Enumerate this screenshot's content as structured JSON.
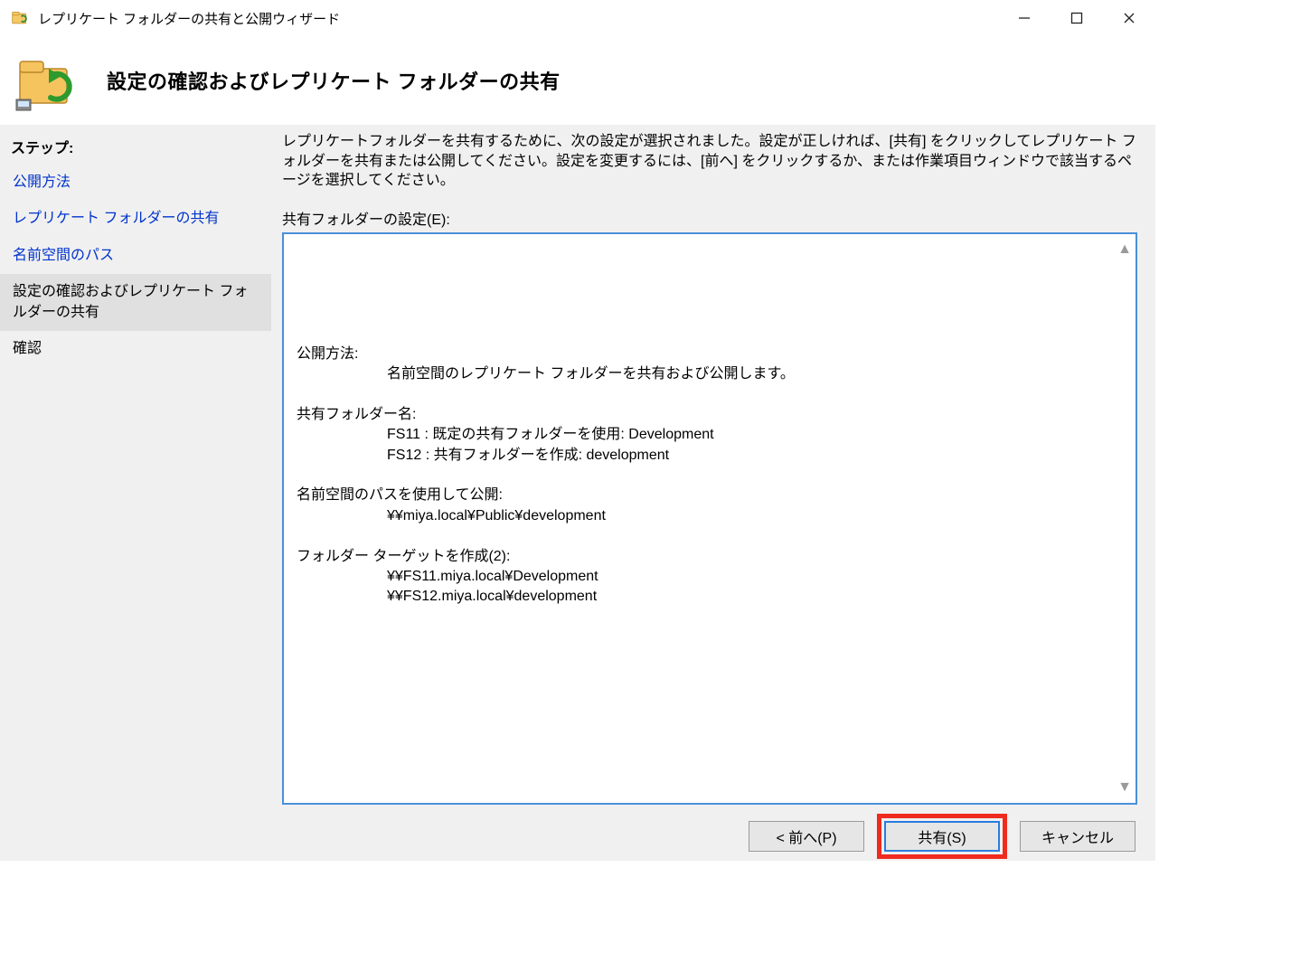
{
  "window": {
    "title": "レプリケート フォルダーの共有と公開ウィザード"
  },
  "header": {
    "heading": "設定の確認およびレプリケート フォルダーの共有"
  },
  "sidebar": {
    "steps_label": "ステップ:",
    "steps": [
      {
        "label": "公開方法"
      },
      {
        "label": "レプリケート フォルダーの共有"
      },
      {
        "label": "名前空間のパス"
      },
      {
        "label": "設定の確認およびレプリケート フォルダーの共有"
      },
      {
        "label": "確認"
      }
    ]
  },
  "content": {
    "instructions": "レプリケートフォルダーを共有するために、次の設定が選択されました。設定が正しければ、[共有] をクリックしてレプリケート フォルダーを共有または公開してください。設定を変更するには、[前へ] をクリックするか、または作業項目ウィンドウで該当するページを選択してください。",
    "settings_label": "共有フォルダーの設定(E):",
    "settings": {
      "s1_label": "公開方法:",
      "s1_line1": "名前空間のレプリケート フォルダーを共有および公開します。",
      "s2_label": "共有フォルダー名:",
      "s2_line1": "FS11 : 既定の共有フォルダーを使用: Development",
      "s2_line2": "FS12 : 共有フォルダーを作成: development",
      "s3_label": "名前空間のパスを使用して公開:",
      "s3_line1": "¥¥miya.local¥Public¥development",
      "s4_label": "フォルダー ターゲットを作成(2):",
      "s4_line1": "¥¥FS11.miya.local¥Development",
      "s4_line2": "¥¥FS12.miya.local¥development"
    }
  },
  "footer": {
    "back": "< 前へ(P)",
    "share": "共有(S)",
    "cancel": "キャンセル"
  }
}
